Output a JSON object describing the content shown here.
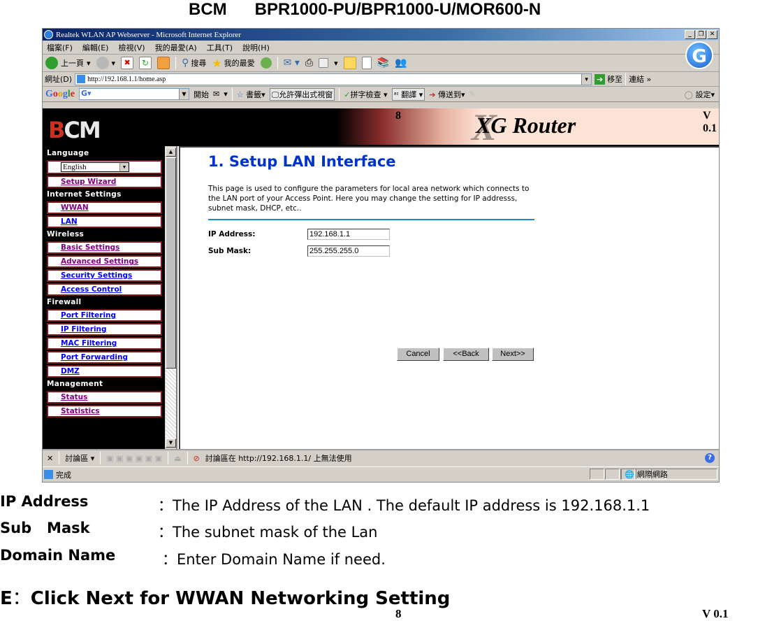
{
  "doc": {
    "title_brand": "BCM",
    "title_models": "BPR1000-PU/BPR1000-U/MOR600-N",
    "page_number": "8",
    "version": "V 0.1",
    "definitions": [
      {
        "term": "IP Address",
        "desc": "：The IP Address of the LAN . The default IP address is 192.168.1.1"
      },
      {
        "term": "Sub   Mask",
        "desc": "：The subnet mask of the Lan"
      },
      {
        "term": "Domain Name",
        "desc": "：Enter Domain Name if need."
      }
    ],
    "step": {
      "letter": "E",
      "colon": "：",
      "text": "Click Next for WWAN Networking Setting"
    }
  },
  "browser": {
    "window_title": "Realtek WLAN AP Webserver - Microsoft Internet Explorer",
    "window_buttons": [
      "_",
      "❐",
      "✕"
    ],
    "menu": [
      "檔案(F)",
      "編輯(E)",
      "檢視(V)",
      "我的最愛(A)",
      "工具(T)",
      "說明(H)"
    ],
    "toolbar": {
      "back": "上一頁",
      "search": "搜尋",
      "favorites": "我的最愛"
    },
    "address": {
      "label": "網址(D)",
      "url": "http://192.168.1.1/home.asp",
      "go": "移至",
      "links": "連結"
    },
    "google_bar": {
      "logo": "Google",
      "start": "開始",
      "bookmarks": "書籤▾",
      "popup_allowed": "允許彈出式視窗",
      "spellcheck": "拼字檢查",
      "translate": "翻譯",
      "send_to": "傳送到▾",
      "settings": "設定▾"
    },
    "discussion_bar": {
      "label": "討論區 ▾",
      "message": "討論區在 http://192.168.1.1/ 上無法使用"
    },
    "status": {
      "text": "完成",
      "zone": "網際網路"
    }
  },
  "router": {
    "header": {
      "logo": "BCM",
      "product": "XG Router",
      "page_number": "8",
      "version": "V 0.1"
    },
    "sidebar": {
      "sections": [
        {
          "title": "Language",
          "language_value": "English"
        },
        {
          "title": null,
          "items": [
            {
              "label": "Setup Wizard",
              "visited": true
            }
          ]
        },
        {
          "title": "Internet Settings",
          "items": [
            {
              "label": "WWAN",
              "visited": true
            },
            {
              "label": "LAN",
              "visited": false
            }
          ]
        },
        {
          "title": "Wireless",
          "items": [
            {
              "label": "Basic Settings",
              "visited": true
            },
            {
              "label": "Advanced Settings",
              "visited": true
            },
            {
              "label": "Security Settings",
              "visited": false
            },
            {
              "label": "Access Control",
              "visited": false
            }
          ]
        },
        {
          "title": "Firewall",
          "items": [
            {
              "label": "Port Filtering",
              "visited": false
            },
            {
              "label": "IP Filtering",
              "visited": false
            },
            {
              "label": "MAC Filtering",
              "visited": false
            },
            {
              "label": "Port Forwarding",
              "visited": false
            },
            {
              "label": "DMZ",
              "visited": false
            }
          ]
        },
        {
          "title": "Management",
          "items": [
            {
              "label": "Status",
              "visited": true
            },
            {
              "label": "Statistics",
              "visited": true
            }
          ]
        }
      ]
    },
    "main": {
      "heading": "1. Setup LAN Interface",
      "description": "This page is used to configure the parameters for local area network which connects to the LAN port of your Access Point. Here you may change the setting for IP addresss, subnet mask, DHCP, etc..",
      "fields": [
        {
          "label": "IP Address:",
          "value": "192.168.1.1"
        },
        {
          "label": "Sub Mask:",
          "value": "255.255.255.0"
        }
      ],
      "buttons": {
        "cancel": "Cancel",
        "back": "<<Back",
        "next": "Next>>"
      }
    }
  }
}
